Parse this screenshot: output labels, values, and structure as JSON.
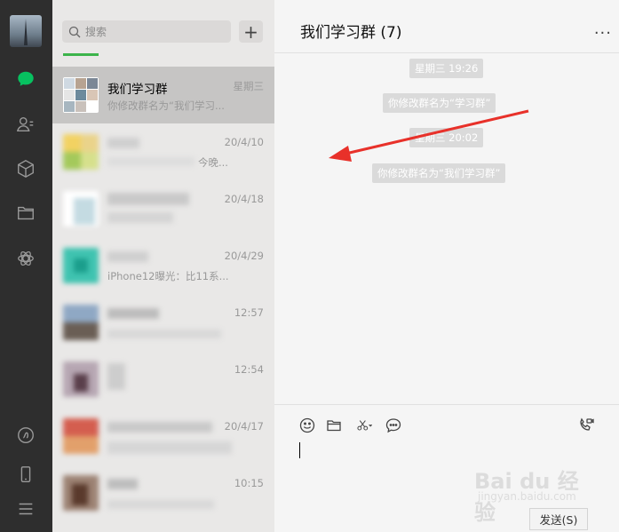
{
  "search": {
    "placeholder": "搜索"
  },
  "add_button": "+",
  "chats": [
    {
      "name": "我们学习群",
      "time": "星期三",
      "msg": "你修改群名为“我们学习..."
    },
    {
      "name": "",
      "time": "20/4/10",
      "msg": "今晚..."
    },
    {
      "name": "",
      "time": "20/4/18",
      "msg": ""
    },
    {
      "name": "",
      "time": "20/4/29",
      "msg": "iPhone12曝光：比11系..."
    },
    {
      "name": "",
      "time": "12:57",
      "msg": ""
    },
    {
      "name": "",
      "time": "12:54",
      "msg": ""
    },
    {
      "name": "",
      "time": "20/4/17",
      "msg": ""
    },
    {
      "name": "",
      "time": "10:15",
      "msg": ""
    }
  ],
  "chat": {
    "title": "我们学习群 (7)",
    "more": "...",
    "messages": [
      {
        "type": "time",
        "text": "星期三 19:26"
      },
      {
        "type": "system",
        "text": "你修改群名为“学习群”"
      },
      {
        "type": "time",
        "text": "星期三 20:02"
      },
      {
        "type": "system",
        "text": "你修改群名为“我们学习群”"
      }
    ],
    "send_label": "发送(S)"
  },
  "watermark": {
    "main": "Bai du 经验",
    "sub": "jingyan.baidu.com"
  },
  "icons": {
    "nav": [
      "chat-icon",
      "contacts-icon",
      "favorites-icon",
      "files-icon",
      "moments-icon",
      "miniprogram-icon",
      "phone-icon",
      "menu-icon"
    ],
    "toolbar": [
      "emoji-icon",
      "folder-icon",
      "scissors-icon",
      "chat-bubble-icon",
      "video-call-icon"
    ]
  },
  "colors": {
    "accent": "#07c160",
    "arrow": "#e8312a",
    "nav_bg": "#2e2e2e",
    "list_bg": "#e9e8e7"
  }
}
